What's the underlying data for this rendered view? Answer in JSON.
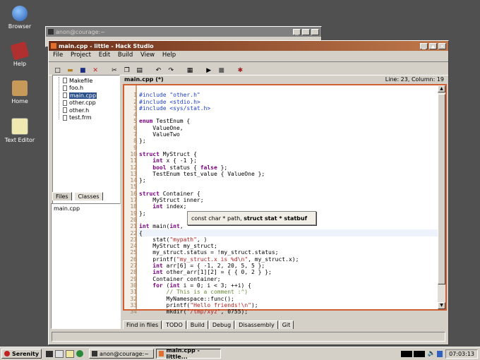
{
  "desktop": {
    "icons": [
      {
        "label": "Browser",
        "icon": "globe-icon",
        "color": "#3a7bd5"
      },
      {
        "label": "Help",
        "icon": "help-book-icon",
        "color": "#c0392b"
      },
      {
        "label": "Home",
        "icon": "home-folder-icon",
        "color": "#8a6d3b"
      },
      {
        "label": "Text Editor",
        "icon": "text-editor-icon",
        "color": "#f0e8a0"
      }
    ]
  },
  "terminal": {
    "title": "anon@courage:~"
  },
  "ide": {
    "title": "main.cpp - little - Hack Studio",
    "menu": [
      "File",
      "Project",
      "Edit",
      "Build",
      "View",
      "Help"
    ],
    "editor_tab_label": "main.cpp (*)",
    "position_label": "Line: 23, Column: 19",
    "files": [
      "Makefile",
      "foo.h",
      "main.cpp",
      "other.cpp",
      "other.h",
      "test.frm"
    ],
    "side_tabs": [
      "Files",
      "Classes"
    ],
    "open_files": [
      "main.cpp"
    ],
    "bottom_tabs": [
      "Find in files",
      "TODO",
      "Build",
      "Debug",
      "Disassembly",
      "Git"
    ],
    "autocomplete": {
      "prefix": "const char * path, ",
      "bold": "struct stat * statbuf"
    }
  },
  "taskbar": {
    "start_label": "Serenity",
    "tasks": [
      "anon@courage:~",
      "main.cpp - little..."
    ],
    "clock": "07:03:13"
  }
}
